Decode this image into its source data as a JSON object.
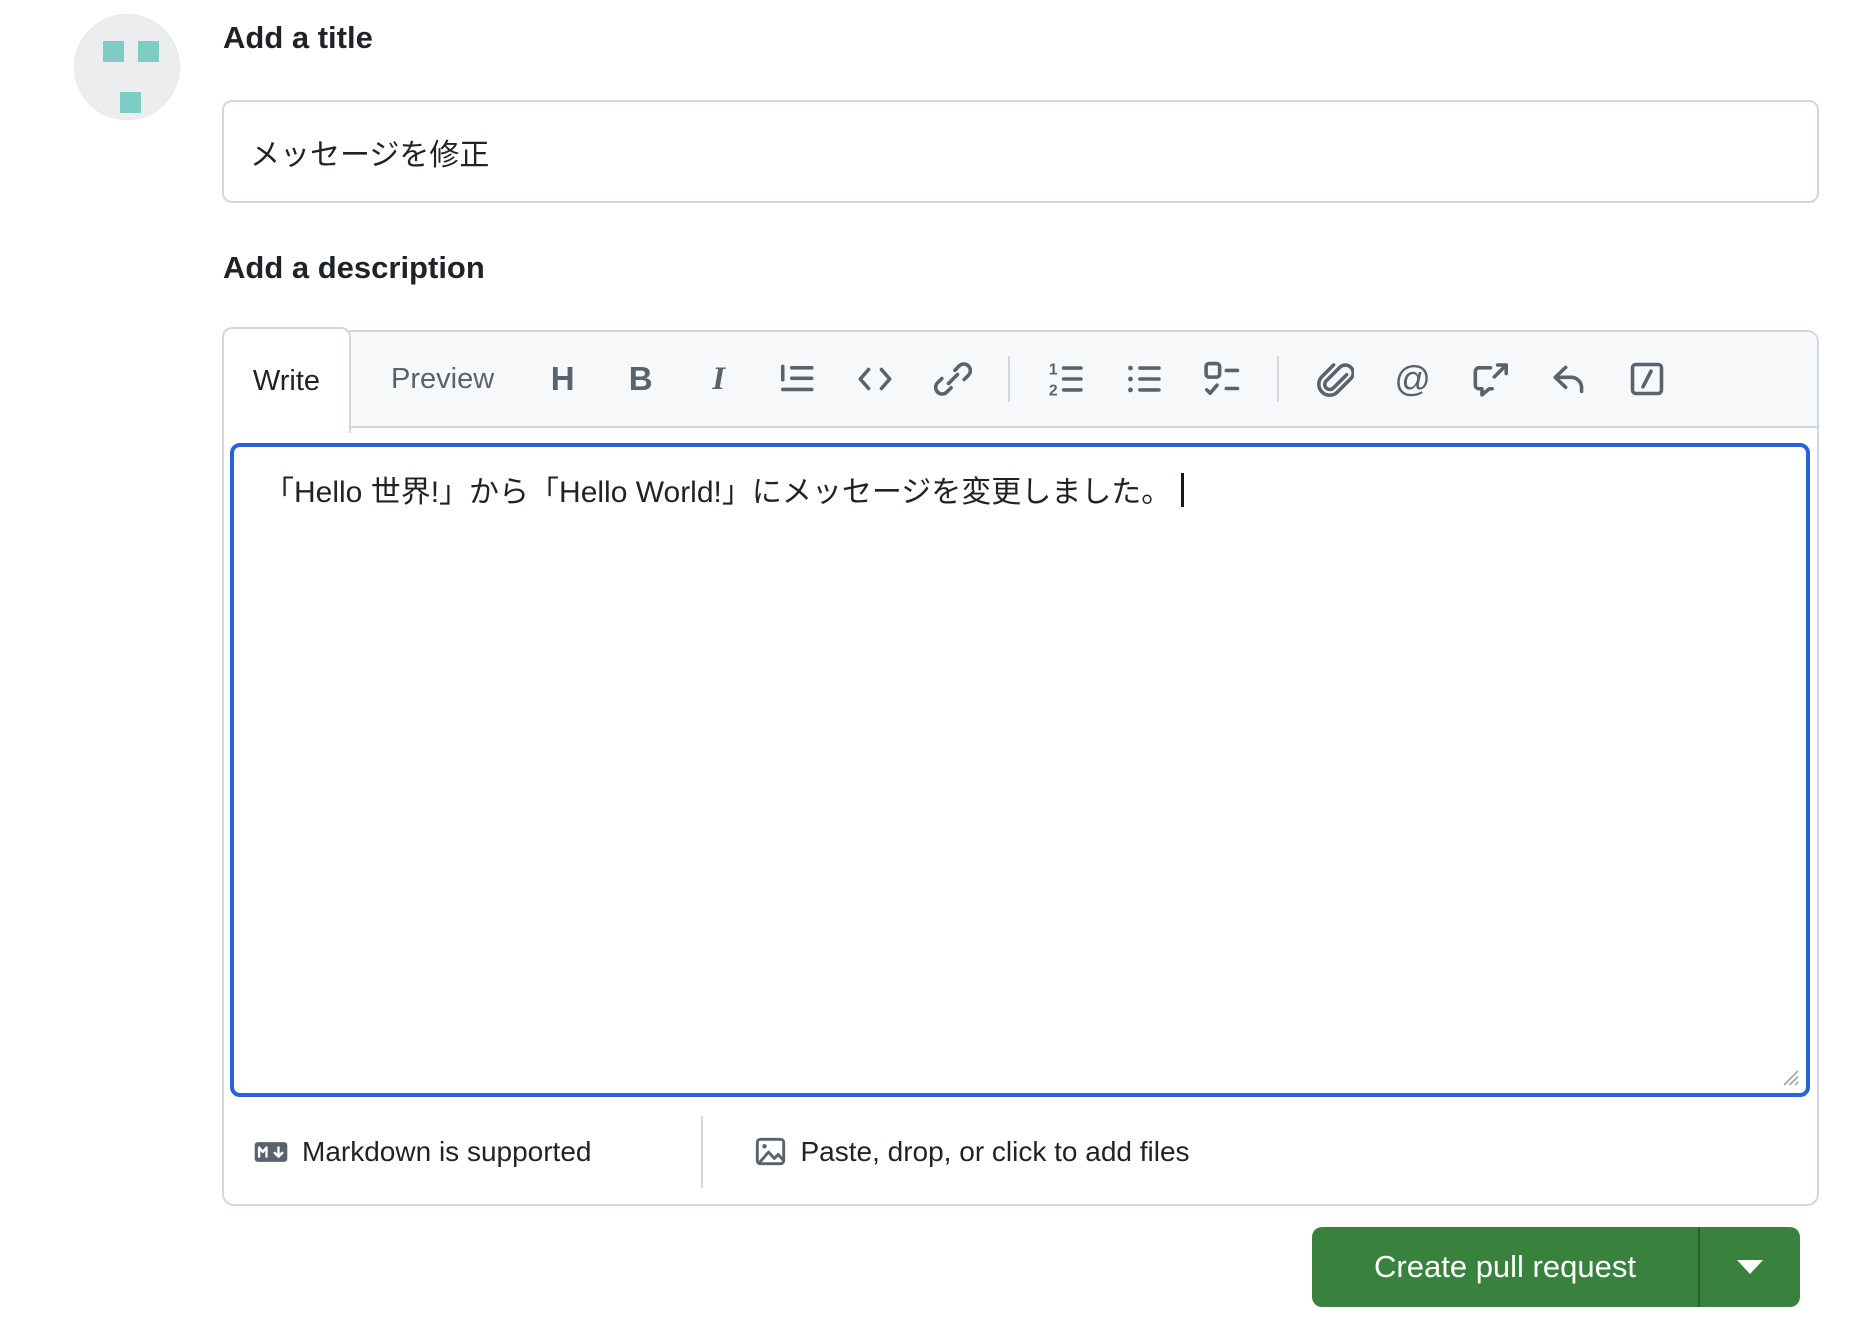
{
  "colors": {
    "focus_blue": "#2b62d9",
    "button_green": "#38823e",
    "border_gray": "#d0d7de",
    "toolbar_bg": "#f6f8fa",
    "icon_gray": "#59636e",
    "avatar_bg": "#ebedef",
    "identicon_teal": "#7dccc6"
  },
  "avatar": {
    "icon": "identicon-avatar"
  },
  "title_section": {
    "label": "Add a title",
    "input_value": "メッセージを修正"
  },
  "description_section": {
    "label": "Add a description",
    "tabs": {
      "write": "Write",
      "preview": "Preview"
    },
    "toolbar_icons": [
      "heading-icon",
      "bold-icon",
      "italic-icon",
      "quote-icon",
      "code-icon",
      "link-icon",
      "numbered-list-icon",
      "bullet-list-icon",
      "task-list-icon",
      "attach-file-icon",
      "mention-icon",
      "cross-reference-icon",
      "reply-icon",
      "slash-command-icon"
    ],
    "glyphs": {
      "heading": "H",
      "bold": "B",
      "italic": "I",
      "mention": "@",
      "list_one": "1",
      "list_two": "2"
    },
    "textarea_value": "「Hello 世界!」から「Hello World!」にメッセージを変更しました。",
    "footer": {
      "markdown_hint": "Markdown is supported",
      "attach_hint": "Paste, drop, or click to add files"
    }
  },
  "actions": {
    "create_pull_request": "Create pull request"
  }
}
